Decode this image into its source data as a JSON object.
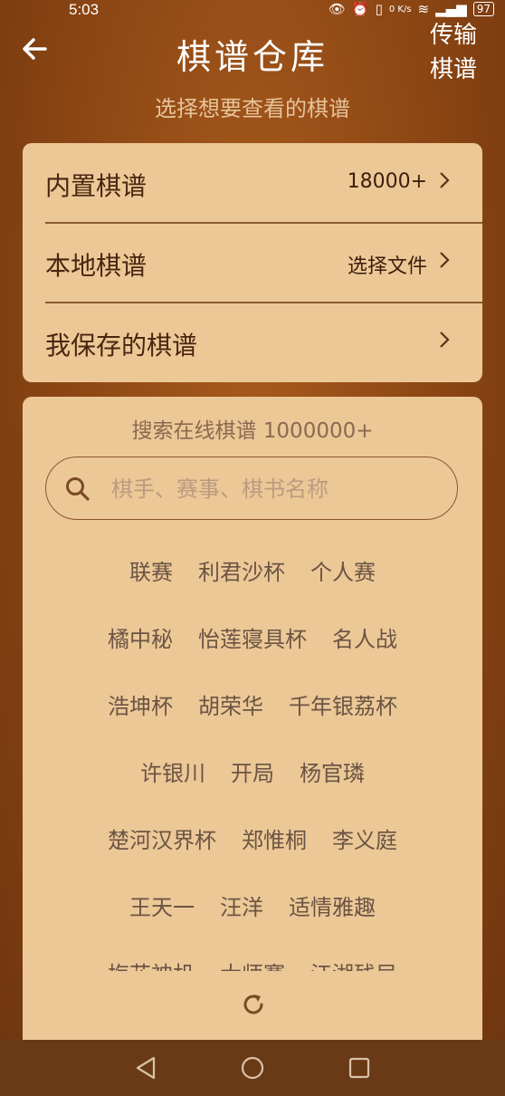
{
  "status_bar": {
    "time": "5:03",
    "network_speed": "0 K/s",
    "battery": "97"
  },
  "header": {
    "title": "棋谱仓库",
    "transfer_label": "传输棋谱",
    "subtitle": "选择想要查看的棋谱"
  },
  "sources": [
    {
      "label": "内置棋谱",
      "value": "18000+"
    },
    {
      "label": "本地棋谱",
      "value": "选择文件"
    },
    {
      "label": "我保存的棋谱",
      "value": ""
    }
  ],
  "online": {
    "title": "搜索在线棋谱 1000000+",
    "search_placeholder": "棋手、赛事、棋书名称",
    "tag_rows": [
      [
        "联赛",
        "利君沙杯",
        "个人赛"
      ],
      [
        "橘中秘",
        "怡莲寝具杯",
        "名人战"
      ],
      [
        "浩坤杯",
        "胡荣华",
        "千年银荔杯"
      ],
      [
        "许银川",
        "开局",
        "杨官璘"
      ],
      [
        "楚河汉界杯",
        "郑惟桐",
        "李义庭"
      ],
      [
        "王天一",
        "汪洋",
        "适情雅趣"
      ],
      [
        "梅花神机",
        "大师赛",
        "江湖残局"
      ]
    ]
  },
  "colors": {
    "card_bg": "#ecc897",
    "accent_brown": "#8b5530",
    "background": "#8a4513"
  },
  "icons": [
    "back-arrow-icon",
    "chevron-right-icon",
    "search-icon",
    "refresh-icon",
    "nav-back-icon",
    "nav-home-icon",
    "nav-recents-icon"
  ]
}
